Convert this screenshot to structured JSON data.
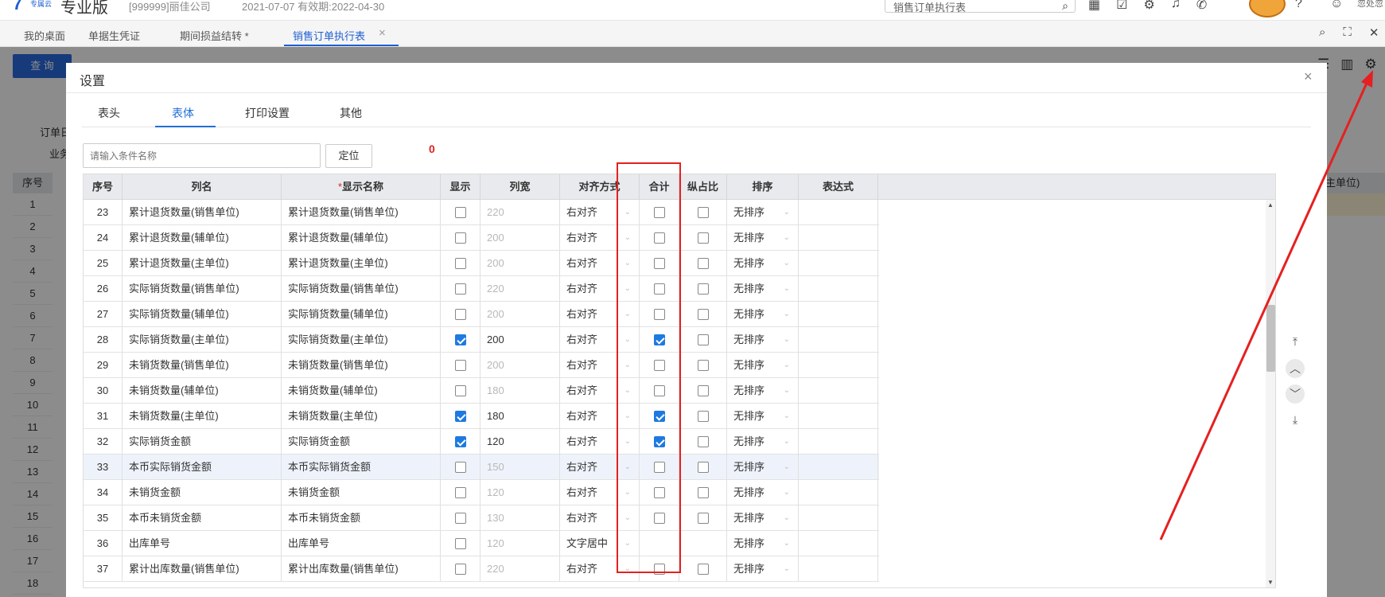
{
  "topbar": {
    "logo_text": "7",
    "logo_sub": "专属云",
    "edition": "专业版",
    "company": "[999999]丽佳公司",
    "dates": "2021-07-07   有效期:2022-04-30",
    "search_text": "销售订单执行表",
    "user_name": "忽处忽"
  },
  "tabs": [
    {
      "label": "我的桌面"
    },
    {
      "label": "单据生凭证"
    },
    {
      "label": "期间损益结转 *"
    },
    {
      "label": "销售订单执行表"
    }
  ],
  "background": {
    "query_button": "查 询",
    "label_order": "订单日",
    "label_biz": "业务",
    "seq_header": "序号",
    "right_header": "主单位)",
    "row_numbers": [
      "1",
      "2",
      "3",
      "4",
      "5",
      "6",
      "7",
      "8",
      "9",
      "10",
      "11",
      "12",
      "13",
      "14",
      "15",
      "16",
      "17",
      "18"
    ]
  },
  "dialog": {
    "title": "设置",
    "tabs": [
      "表头",
      "表体",
      "打印设置",
      "其他"
    ],
    "active_tab": "表体",
    "search_placeholder": "请输入条件名称",
    "locate_button": "定位",
    "annotation_zero": "0",
    "columns": {
      "seq": "序号",
      "name": "列名",
      "display_required": "*",
      "display_name": "显示名称",
      "show": "显示",
      "width": "列宽",
      "align": "对齐方式",
      "total": "合计",
      "ratio": "纵占比",
      "sort": "排序",
      "expr": "表达式"
    },
    "rows": [
      {
        "seq": "23",
        "name": "累计退货数量(销售单位)",
        "display": "累计退货数量(销售单位)",
        "show": false,
        "width": "220",
        "align": "右对齐",
        "total": false,
        "has_total": true,
        "ratio": false,
        "has_ratio": true,
        "sort": "无排序"
      },
      {
        "seq": "24",
        "name": "累计退货数量(辅单位)",
        "display": "累计退货数量(辅单位)",
        "show": false,
        "width": "200",
        "align": "右对齐",
        "total": false,
        "has_total": true,
        "ratio": false,
        "has_ratio": true,
        "sort": "无排序"
      },
      {
        "seq": "25",
        "name": "累计退货数量(主单位)",
        "display": "累计退货数量(主单位)",
        "show": false,
        "width": "200",
        "align": "右对齐",
        "total": false,
        "has_total": true,
        "ratio": false,
        "has_ratio": true,
        "sort": "无排序"
      },
      {
        "seq": "26",
        "name": "实际销货数量(销售单位)",
        "display": "实际销货数量(销售单位)",
        "show": false,
        "width": "220",
        "align": "右对齐",
        "total": false,
        "has_total": true,
        "ratio": false,
        "has_ratio": true,
        "sort": "无排序"
      },
      {
        "seq": "27",
        "name": "实际销货数量(辅单位)",
        "display": "实际销货数量(辅单位)",
        "show": false,
        "width": "200",
        "align": "右对齐",
        "total": false,
        "has_total": true,
        "ratio": false,
        "has_ratio": true,
        "sort": "无排序"
      },
      {
        "seq": "28",
        "name": "实际销货数量(主单位)",
        "display": "实际销货数量(主单位)",
        "show": true,
        "width": "200",
        "align": "右对齐",
        "total": true,
        "has_total": true,
        "ratio": false,
        "has_ratio": true,
        "sort": "无排序"
      },
      {
        "seq": "29",
        "name": "未销货数量(销售单位)",
        "display": "未销货数量(销售单位)",
        "show": false,
        "width": "200",
        "align": "右对齐",
        "total": false,
        "has_total": true,
        "ratio": false,
        "has_ratio": true,
        "sort": "无排序"
      },
      {
        "seq": "30",
        "name": "未销货数量(辅单位)",
        "display": "未销货数量(辅单位)",
        "show": false,
        "width": "180",
        "align": "右对齐",
        "total": false,
        "has_total": true,
        "ratio": false,
        "has_ratio": true,
        "sort": "无排序"
      },
      {
        "seq": "31",
        "name": "未销货数量(主单位)",
        "display": "未销货数量(主单位)",
        "show": true,
        "width": "180",
        "align": "右对齐",
        "total": true,
        "has_total": true,
        "ratio": false,
        "has_ratio": true,
        "sort": "无排序"
      },
      {
        "seq": "32",
        "name": "实际销货金额",
        "display": "实际销货金额",
        "show": true,
        "width": "120",
        "align": "右对齐",
        "total": true,
        "has_total": true,
        "ratio": false,
        "has_ratio": true,
        "sort": "无排序"
      },
      {
        "seq": "33",
        "name": "本币实际销货金额",
        "display": "本币实际销货金额",
        "show": false,
        "width": "150",
        "align": "右对齐",
        "total": false,
        "has_total": true,
        "ratio": false,
        "has_ratio": true,
        "sort": "无排序",
        "highlight": true
      },
      {
        "seq": "34",
        "name": "未销货金额",
        "display": "未销货金额",
        "show": false,
        "width": "120",
        "align": "右对齐",
        "total": false,
        "has_total": true,
        "ratio": false,
        "has_ratio": true,
        "sort": "无排序"
      },
      {
        "seq": "35",
        "name": "本币未销货金额",
        "display": "本币未销货金额",
        "show": false,
        "width": "130",
        "align": "右对齐",
        "total": false,
        "has_total": true,
        "ratio": false,
        "has_ratio": true,
        "sort": "无排序"
      },
      {
        "seq": "36",
        "name": "出库单号",
        "display": "出库单号",
        "show": false,
        "width": "120",
        "align": "文字居中",
        "total": false,
        "has_total": false,
        "ratio": false,
        "has_ratio": false,
        "sort": "无排序"
      },
      {
        "seq": "37",
        "name": "累计出库数量(销售单位)",
        "display": "累计出库数量(销售单位)",
        "show": false,
        "width": "220",
        "align": "右对齐",
        "total": false,
        "has_total": true,
        "ratio": false,
        "has_ratio": true,
        "sort": "无排序"
      }
    ]
  },
  "colors": {
    "accent": "#1f6fd6",
    "checkbox": "#1e7ae0",
    "annotation": "#e52020",
    "query_button": "#2b6be0"
  },
  "icons": {
    "move_top": "move-to-top-icon",
    "move_up": "move-up-icon",
    "move_down": "move-down-icon",
    "move_bottom": "move-to-bottom-icon",
    "settings": "gear-icon"
  }
}
